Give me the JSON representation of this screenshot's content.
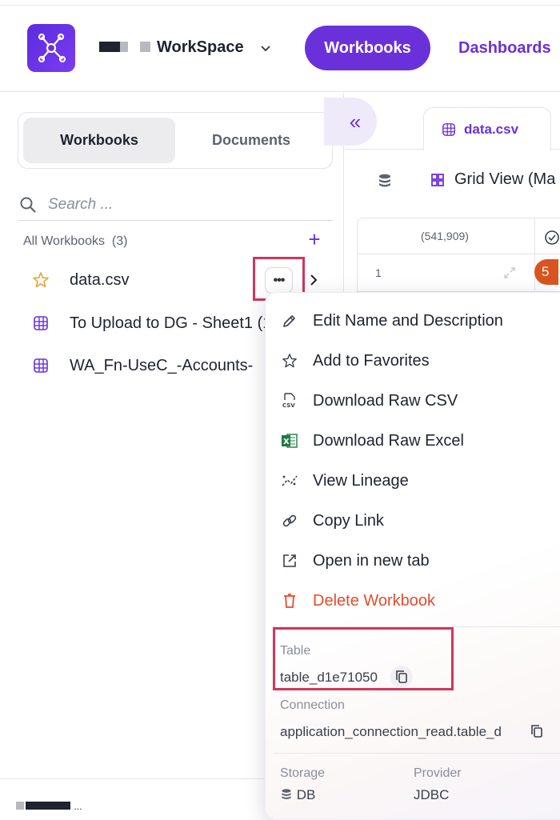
{
  "header": {
    "workspace_name": "WorkSpace",
    "nav": [
      {
        "label": "Workbooks",
        "active": true
      },
      {
        "label": "Dashboards",
        "active": false
      }
    ]
  },
  "sidebar": {
    "segments": [
      "Workbooks",
      "Documents"
    ],
    "active_segment": "Workbooks",
    "search_placeholder": "Search ...",
    "all_workbooks_label": "All Workbooks",
    "all_workbooks_count": "(3)",
    "items": [
      {
        "name": "data.csv",
        "icon": "star-icon"
      },
      {
        "name": "To Upload to DG - Sheet1 (1",
        "icon": "sheet-grid-icon"
      },
      {
        "name": "WA_Fn-UseC_-Accounts-",
        "icon": "sheet-grid-icon"
      }
    ],
    "footer_text": "..."
  },
  "main": {
    "tab_label": "data.csv",
    "view_label": "Grid View (Ma",
    "row_count": "(541,909)",
    "first_row_number": "1",
    "first_cell_value": "5"
  },
  "menu": {
    "items": [
      {
        "label": "Edit Name and Description",
        "icon": "pencil-icon"
      },
      {
        "label": "Add to Favorites",
        "icon": "star-outline-icon"
      },
      {
        "label": "Download Raw CSV",
        "icon": "csv-file-icon"
      },
      {
        "label": "Download Raw Excel",
        "icon": "excel-icon"
      },
      {
        "label": "View Lineage",
        "icon": "lineage-icon"
      },
      {
        "label": "Copy Link",
        "icon": "link-icon"
      },
      {
        "label": "Open in new tab",
        "icon": "external-link-icon"
      },
      {
        "label": "Delete Workbook",
        "icon": "trash-icon",
        "danger": true
      }
    ],
    "table_label": "Table",
    "table_value": "table_d1e71050",
    "connection_label": "Connection",
    "connection_value": "application_connection_read.table_d",
    "storage_label": "Storage",
    "storage_value": "DB",
    "provider_label": "Provider",
    "provider_value": "JDBC"
  },
  "colors": {
    "accent": "#6a31db",
    "danger": "#e34d2e",
    "highlight": "#d0365a",
    "star": "#e9a23b",
    "excel": "#1e7a45"
  }
}
